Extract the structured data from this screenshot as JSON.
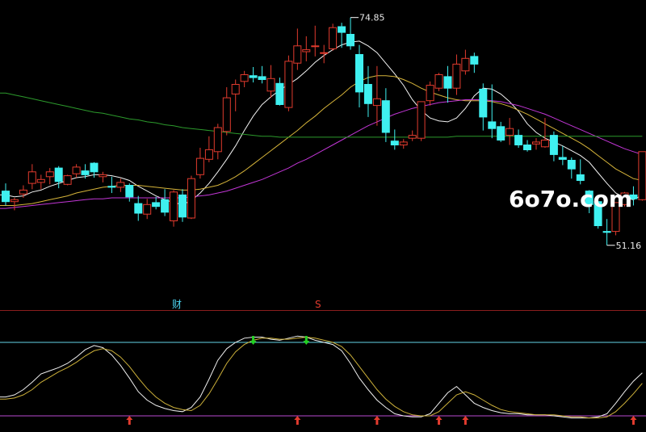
{
  "watermark": "6o7o.com",
  "markers": {
    "cai": "财",
    "s": "S"
  },
  "colors": {
    "background": "#000000",
    "up": "#e23b2e",
    "down": "#3ff0f0",
    "ma_white": "#f2f2f2",
    "ma_yellow": "#d6b43a",
    "ma_magenta": "#c236d6",
    "ma_green": "#2c9a2c",
    "osc_k": "#f0f0f0",
    "osc_d": "#cdb13a",
    "ref_line": "#63d3e6",
    "floor_line": "#b84ad0",
    "divider": "#8a1e1e",
    "buy_arrow": "#e23b2e",
    "sell_arrow": "#22d122"
  },
  "chart_data": [
    {
      "type": "candlestick",
      "title": "",
      "price_range": [
        45.6,
        76.0
      ],
      "high_label": "74.85",
      "low_label": "51.16",
      "high_value": 74.85,
      "low_value": 51.16,
      "candles": [
        [
          56.8,
          57.6,
          55.3,
          55.7
        ],
        [
          55.7,
          56.1,
          54.8,
          55.9
        ],
        [
          56.5,
          57.4,
          56.1,
          56.9
        ],
        [
          57.6,
          59.6,
          57.0,
          58.8
        ],
        [
          57.7,
          58.5,
          57.0,
          58.0
        ],
        [
          58.3,
          59.2,
          57.5,
          58.8
        ],
        [
          59.2,
          59.4,
          57.1,
          57.8
        ],
        [
          57.5,
          58.5,
          57.4,
          58.4
        ],
        [
          58.6,
          59.6,
          58.2,
          59.3
        ],
        [
          58.9,
          59.6,
          58.1,
          58.5
        ],
        [
          59.7,
          59.8,
          58.2,
          58.8
        ],
        [
          58.3,
          58.8,
          57.7,
          58.5
        ],
        [
          57.3,
          58.3,
          56.6,
          57.2
        ],
        [
          57.2,
          58.1,
          56.7,
          57.7
        ],
        [
          57.4,
          57.6,
          55.7,
          56.2
        ],
        [
          55.5,
          56.3,
          53.7,
          54.5
        ],
        [
          54.4,
          56.0,
          53.9,
          55.4
        ],
        [
          55.6,
          56.2,
          54.9,
          55.2
        ],
        [
          55.9,
          57.0,
          54.2,
          54.6
        ],
        [
          53.7,
          56.9,
          53.1,
          56.7
        ],
        [
          56.4,
          57.0,
          53.6,
          54.1
        ],
        [
          54.0,
          58.4,
          53.9,
          58.1
        ],
        [
          58.5,
          61.3,
          58.1,
          60.2
        ],
        [
          60.1,
          62.5,
          59.8,
          61.1
        ],
        [
          60.9,
          63.8,
          60.1,
          63.4
        ],
        [
          63.0,
          67.6,
          62.6,
          66.5
        ],
        [
          66.9,
          68.4,
          65.1,
          67.9
        ],
        [
          68.2,
          69.3,
          67.6,
          68.9
        ],
        [
          68.8,
          69.7,
          68.1,
          68.6
        ],
        [
          68.7,
          69.8,
          68.0,
          68.4
        ],
        [
          67.2,
          69.9,
          66.5,
          68.5
        ],
        [
          68.0,
          68.6,
          65.7,
          65.8
        ],
        [
          65.5,
          70.9,
          65.1,
          70.3
        ],
        [
          70.1,
          73.7,
          69.4,
          71.9
        ],
        [
          71.3,
          72.9,
          70.3,
          71.5
        ],
        [
          71.9,
          74.0,
          70.8,
          71.9
        ],
        [
          71.2,
          72.0,
          70.1,
          71.2
        ],
        [
          71.6,
          74.2,
          71.4,
          73.8
        ],
        [
          73.9,
          74.3,
          71.7,
          73.3
        ],
        [
          73.1,
          74.85,
          71.5,
          71.9
        ],
        [
          71.0,
          72.0,
          65.5,
          67.1
        ],
        [
          67.9,
          69.8,
          64.5,
          65.9
        ],
        [
          65.7,
          69.8,
          63.6,
          66.4
        ],
        [
          66.2,
          67.5,
          61.9,
          62.9
        ],
        [
          62.0,
          63.2,
          61.1,
          61.6
        ],
        [
          61.6,
          62.2,
          61.2,
          61.9
        ],
        [
          62.3,
          63.1,
          62.0,
          62.6
        ],
        [
          62.3,
          66.1,
          62.0,
          66.1
        ],
        [
          66.2,
          68.2,
          65.7,
          67.8
        ],
        [
          67.5,
          69.1,
          67.2,
          68.9
        ],
        [
          68.7,
          69.8,
          66.0,
          67.5
        ],
        [
          67.5,
          71.0,
          66.8,
          70.0
        ],
        [
          69.3,
          71.5,
          68.9,
          70.6
        ],
        [
          70.8,
          71.2,
          69.1,
          70.0
        ],
        [
          67.4,
          68.0,
          63.1,
          64.5
        ],
        [
          64.0,
          67.9,
          62.3,
          63.3
        ],
        [
          63.5,
          64.0,
          61.9,
          62.1
        ],
        [
          62.6,
          64.4,
          61.6,
          63.3
        ],
        [
          62.6,
          63.2,
          61.3,
          61.6
        ],
        [
          61.6,
          62.1,
          60.9,
          61.1
        ],
        [
          61.7,
          62.3,
          61.1,
          61.9
        ],
        [
          61.4,
          64.4,
          61.3,
          62.1
        ],
        [
          62.6,
          63.0,
          59.9,
          60.6
        ],
        [
          60.3,
          61.5,
          59.5,
          60.1
        ],
        [
          60.0,
          60.3,
          58.1,
          59.1
        ],
        [
          58.5,
          60.1,
          57.5,
          57.9
        ],
        [
          56.8,
          56.9,
          54.5,
          55.4
        ],
        [
          55.7,
          56.2,
          52.9,
          53.2
        ],
        [
          52.6,
          53.9,
          51.16,
          52.5
        ],
        [
          52.6,
          55.5,
          52.2,
          55.6
        ],
        [
          55.4,
          56.7,
          55.2,
          56.6
        ],
        [
          56.4,
          57.3,
          55.3,
          56.0
        ],
        [
          55.9,
          60.7,
          55.8,
          60.9
        ]
      ],
      "moving_averages": [
        {
          "color_key": "ma_white",
          "values": [
            56.4,
            56.2,
            56.3,
            56.7,
            56.9,
            57.3,
            57.6,
            57.9,
            58.2,
            58.3,
            58.5,
            58.5,
            58.4,
            58.2,
            57.9,
            57.3,
            56.8,
            56.3,
            55.9,
            55.6,
            55.4,
            55.8,
            56.6,
            57.6,
            58.8,
            60.1,
            61.5,
            63.1,
            64.6,
            65.8,
            66.6,
            67.3,
            67.9,
            68.5,
            69.3,
            70.2,
            70.9,
            71.5,
            72.0,
            72.3,
            72.4,
            71.9,
            71.2,
            70.1,
            69.0,
            67.8,
            66.3,
            65.2,
            64.4,
            64.1,
            64.0,
            64.4,
            65.4,
            66.7,
            67.5,
            67.4,
            66.9,
            66.1,
            65.1,
            63.8,
            62.9,
            62.3,
            61.9,
            61.5,
            61.0,
            60.5,
            59.8,
            58.7,
            57.6,
            56.6,
            56.1,
            55.9,
            56.4
          ]
        },
        {
          "color_key": "ma_yellow",
          "values": [
            55.3,
            55.3,
            55.4,
            55.5,
            55.7,
            55.9,
            56.1,
            56.3,
            56.6,
            56.8,
            57.0,
            57.2,
            57.3,
            57.4,
            57.4,
            57.4,
            57.3,
            57.2,
            57.1,
            57.0,
            56.9,
            56.9,
            57.0,
            57.2,
            57.4,
            57.8,
            58.3,
            58.9,
            59.6,
            60.3,
            61.0,
            61.7,
            62.4,
            63.1,
            63.9,
            64.6,
            65.4,
            66.1,
            66.8,
            67.6,
            68.2,
            68.6,
            68.8,
            68.8,
            68.7,
            68.4,
            68.0,
            67.5,
            67.1,
            66.8,
            66.5,
            66.3,
            66.2,
            66.2,
            66.2,
            66.1,
            65.9,
            65.6,
            65.2,
            64.8,
            64.3,
            63.8,
            63.3,
            62.8,
            62.3,
            61.8,
            61.2,
            60.5,
            59.8,
            59.1,
            58.6,
            58.1,
            57.9
          ]
        },
        {
          "color_key": "ma_magenta",
          "values": [
            55.0,
            55.1,
            55.2,
            55.3,
            55.4,
            55.5,
            55.6,
            55.7,
            55.8,
            55.9,
            56.0,
            56.0,
            56.1,
            56.1,
            56.1,
            56.1,
            56.1,
            56.1,
            56.1,
            56.1,
            56.1,
            56.2,
            56.3,
            56.4,
            56.6,
            56.8,
            57.1,
            57.4,
            57.7,
            58.0,
            58.4,
            58.8,
            59.2,
            59.7,
            60.1,
            60.6,
            61.1,
            61.6,
            62.1,
            62.6,
            63.1,
            63.6,
            64.0,
            64.4,
            64.8,
            65.1,
            65.4,
            65.6,
            65.8,
            66.0,
            66.1,
            66.2,
            66.3,
            66.3,
            66.3,
            66.2,
            66.1,
            65.9,
            65.7,
            65.4,
            65.1,
            64.8,
            64.4,
            64.0,
            63.6,
            63.2,
            62.8,
            62.4,
            62.0,
            61.6,
            61.2,
            60.9,
            60.6
          ]
        },
        {
          "color_key": "ma_green",
          "values": [
            67.0,
            66.8,
            66.6,
            66.4,
            66.2,
            66.0,
            65.8,
            65.6,
            65.4,
            65.2,
            65.0,
            64.9,
            64.7,
            64.5,
            64.3,
            64.2,
            64.0,
            63.9,
            63.7,
            63.6,
            63.4,
            63.3,
            63.2,
            63.1,
            63.0,
            62.9,
            62.8,
            62.7,
            62.6,
            62.5,
            62.5,
            62.4,
            62.4,
            62.4,
            62.4,
            62.4,
            62.4,
            62.4,
            62.4,
            62.4,
            62.4,
            62.4,
            62.4,
            62.4,
            62.4,
            62.4,
            62.4,
            62.4,
            62.4,
            62.4,
            62.4,
            62.5,
            62.5,
            62.5,
            62.5,
            62.5,
            62.5,
            62.5,
            62.5,
            62.5,
            62.5,
            62.5,
            62.5,
            62.5,
            62.5,
            62.5,
            62.5,
            62.5,
            62.5,
            62.5,
            62.5,
            62.5,
            62.5
          ]
        }
      ]
    },
    {
      "type": "line",
      "title": "",
      "ylim": [
        0,
        100
      ],
      "reference_lines": [
        80,
        10
      ],
      "series": [
        {
          "color_key": "osc_k",
          "values": [
            28,
            30,
            35,
            42,
            50,
            53,
            56,
            60,
            66,
            73,
            77,
            75,
            68,
            58,
            46,
            33,
            25,
            20,
            17,
            15,
            14,
            18,
            28,
            45,
            63,
            74,
            80,
            84,
            85,
            85,
            83,
            82,
            84,
            86,
            85,
            82,
            80,
            78,
            72,
            60,
            46,
            35,
            25,
            18,
            12,
            10,
            9,
            9,
            12,
            22,
            32,
            38,
            30,
            22,
            18,
            15,
            13,
            12,
            12,
            11,
            11,
            11,
            10,
            9,
            8,
            8,
            8,
            9,
            12,
            22,
            33,
            43,
            51
          ]
        },
        {
          "color_key": "osc_d",
          "values": [
            26,
            27,
            30,
            35,
            42,
            47,
            52,
            56,
            61,
            67,
            72,
            74,
            72,
            66,
            57,
            46,
            36,
            28,
            22,
            18,
            16,
            15,
            20,
            31,
            45,
            60,
            71,
            78,
            82,
            84,
            84,
            83,
            83,
            84,
            85,
            84,
            82,
            80,
            76,
            68,
            57,
            46,
            35,
            26,
            19,
            14,
            11,
            10,
            10,
            14,
            22,
            30,
            33,
            30,
            25,
            20,
            16,
            14,
            13,
            12,
            11,
            11,
            11,
            10,
            9,
            9,
            8,
            8,
            9,
            14,
            22,
            31,
            41
          ]
        }
      ],
      "buy_signals": [
        14,
        33,
        42,
        49,
        52,
        71
      ],
      "sell_signals": [
        28,
        34
      ]
    }
  ]
}
